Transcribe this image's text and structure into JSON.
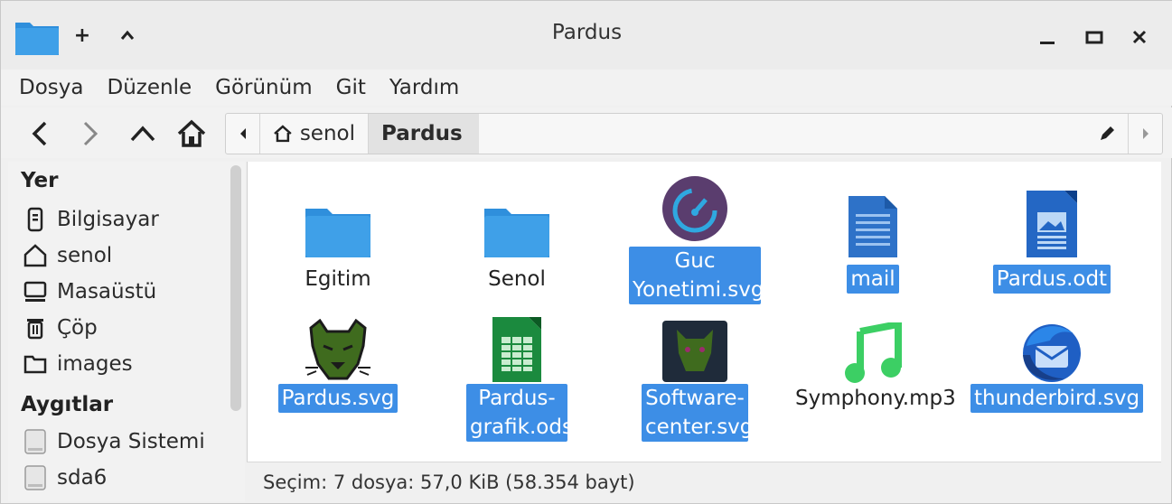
{
  "window": {
    "title": "Pardus"
  },
  "titlebar": {
    "new_tab_glyph": "+",
    "up_glyph": "^"
  },
  "menu": [
    "Dosya",
    "Düzenle",
    "Görünüm",
    "Git",
    "Yardım"
  ],
  "path": {
    "home": "senol",
    "current": "Pardus"
  },
  "sidebar": {
    "places_heading": "Yer",
    "places": [
      {
        "label": "Bilgisayar",
        "icon": "computer-icon"
      },
      {
        "label": "senol",
        "icon": "home-icon"
      },
      {
        "label": "Masaüstü",
        "icon": "desktop-icon"
      },
      {
        "label": "Çöp",
        "icon": "trash-icon"
      },
      {
        "label": "images",
        "icon": "folder-icon"
      }
    ],
    "devices_heading": "Aygıtlar",
    "devices": [
      {
        "label": "Dosya Sistemi",
        "icon": "drive-icon"
      },
      {
        "label": "sda6",
        "icon": "drive-icon"
      }
    ]
  },
  "files": [
    {
      "line1": "Egitim",
      "line2": "",
      "type": "folder",
      "selected": false
    },
    {
      "line1": "Senol",
      "line2": "",
      "type": "folder",
      "selected": false
    },
    {
      "line1": "Guc",
      "line2": "Yonetimi.svg",
      "type": "gauge",
      "selected": true
    },
    {
      "line1": "mail",
      "line2": "",
      "type": "text-doc",
      "selected": true
    },
    {
      "line1": "Pardus.odt",
      "line2": "",
      "type": "writer-doc",
      "selected": true
    },
    {
      "line1": "Pardus.svg",
      "line2": "",
      "type": "leopard",
      "selected": true
    },
    {
      "line1": "Pardus-",
      "line2": "grafik.ods",
      "type": "calc-doc",
      "selected": true
    },
    {
      "line1": "Software-",
      "line2": "center.svg",
      "type": "software-center",
      "selected": true
    },
    {
      "line1": "Symphony.mp3",
      "line2": "",
      "type": "music",
      "selected": false
    },
    {
      "line1": "thunderbird.svg",
      "line2": "",
      "type": "thunderbird",
      "selected": true
    }
  ],
  "status": "Seçim: 7 dosya: 57,0 KiB (58.354 bayt)",
  "colors": {
    "selection": "#3d8ee6",
    "folder": "#3fa0e8"
  }
}
